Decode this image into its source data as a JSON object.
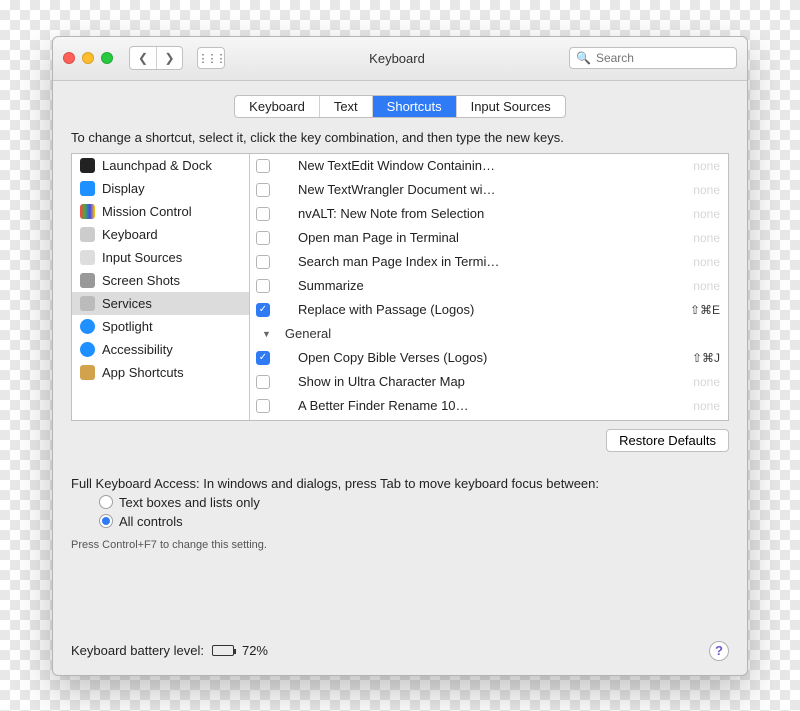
{
  "window": {
    "title": "Keyboard"
  },
  "search": {
    "placeholder": "Search",
    "value": ""
  },
  "tabs": [
    {
      "label": "Keyboard",
      "active": false
    },
    {
      "label": "Text",
      "active": false
    },
    {
      "label": "Shortcuts",
      "active": true
    },
    {
      "label": "Input Sources",
      "active": false
    }
  ],
  "instruction": "To change a shortcut, select it, click the key combination, and then type the new keys.",
  "categories": [
    {
      "label": "Launchpad & Dock",
      "icon": "launchpad",
      "selected": false
    },
    {
      "label": "Display",
      "icon": "display",
      "selected": false
    },
    {
      "label": "Mission Control",
      "icon": "mission",
      "selected": false
    },
    {
      "label": "Keyboard",
      "icon": "keyboard",
      "selected": false
    },
    {
      "label": "Input Sources",
      "icon": "input",
      "selected": false
    },
    {
      "label": "Screen Shots",
      "icon": "screenshot",
      "selected": false
    },
    {
      "label": "Services",
      "icon": "gear",
      "selected": true
    },
    {
      "label": "Spotlight",
      "icon": "spotlight",
      "selected": false
    },
    {
      "label": "Accessibility",
      "icon": "accessibility",
      "selected": false
    },
    {
      "label": "App Shortcuts",
      "icon": "app",
      "selected": false
    }
  ],
  "shortcuts": [
    {
      "type": "item",
      "checked": false,
      "label": "New TextEdit Window Containin…",
      "shortcut": "none"
    },
    {
      "type": "item",
      "checked": false,
      "label": "New TextWrangler Document wi…",
      "shortcut": "none"
    },
    {
      "type": "item",
      "checked": false,
      "label": "nvALT: New Note from Selection",
      "shortcut": "none"
    },
    {
      "type": "item",
      "checked": false,
      "label": "Open man Page in Terminal",
      "shortcut": "none"
    },
    {
      "type": "item",
      "checked": false,
      "label": "Search man Page Index in Termi…",
      "shortcut": "none"
    },
    {
      "type": "item",
      "checked": false,
      "label": "Summarize",
      "shortcut": "none"
    },
    {
      "type": "item",
      "checked": true,
      "label": "Replace with Passage (Logos)",
      "shortcut": "⇧⌘E"
    },
    {
      "type": "group",
      "label": "General"
    },
    {
      "type": "item",
      "checked": true,
      "label": "Open Copy Bible Verses (Logos)",
      "shortcut": "⇧⌘J"
    },
    {
      "type": "item",
      "checked": false,
      "label": "Show in Ultra Character Map",
      "shortcut": "none"
    },
    {
      "type": "item",
      "checked": false,
      "label": "A Better Finder Rename 10…",
      "shortcut": "none"
    }
  ],
  "restore_button": "Restore Defaults",
  "fka": {
    "heading": "Full Keyboard Access: In windows and dialogs, press Tab to move keyboard focus between:",
    "options": [
      {
        "label": "Text boxes and lists only",
        "selected": false
      },
      {
        "label": "All controls",
        "selected": true
      }
    ],
    "hint": "Press Control+F7 to change this setting."
  },
  "footer": {
    "battery_label": "Keyboard battery level:",
    "battery_pct": "72%"
  }
}
